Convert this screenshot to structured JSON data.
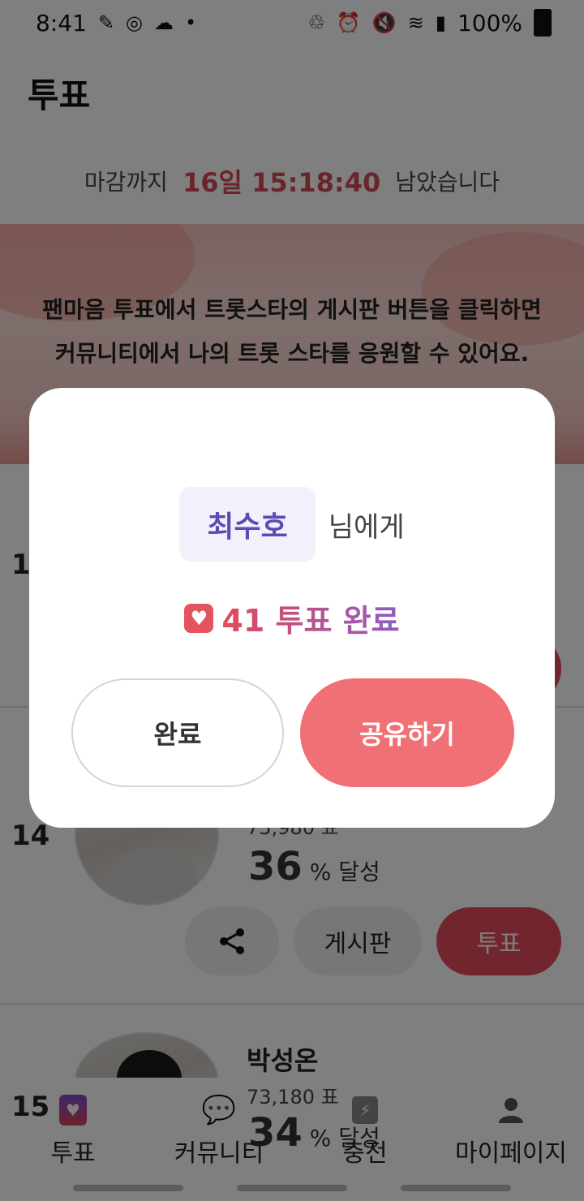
{
  "status_bar": {
    "time": "8:41",
    "battery": "100%"
  },
  "header": {
    "title": "투표"
  },
  "deadline": {
    "prefix": "마감까지",
    "countdown": "16일 15:18:40",
    "suffix": "남았습니다"
  },
  "banner": {
    "line1": "팬마음 투표에서 트롯스타의 게시판 버튼을 클릭하면",
    "line2": "커뮤니티에서 나의 트롯 스타를 응원할 수 있어요."
  },
  "list": [
    {
      "rank": "13",
      "name": "",
      "votes": "",
      "percent": "",
      "percent_label": ""
    },
    {
      "rank": "14",
      "name": "",
      "votes": "73,980 표",
      "percent": "36",
      "percent_label": "% 달성"
    },
    {
      "rank": "15",
      "name": "박성온",
      "votes": "73,180 표",
      "percent": "34",
      "percent_label": "% 달성"
    }
  ],
  "actions": {
    "board": "게시판",
    "vote": "투표"
  },
  "dialog": {
    "recipient": "최수호",
    "recipient_suffix": "님에게",
    "result": "41 투표 완료",
    "done_button": "완료",
    "share_button": "공유하기"
  },
  "bottom_nav": [
    {
      "label": "투표",
      "icon": "vote-heart-icon"
    },
    {
      "label": "커뮤니티",
      "icon": "chat-bubbles-icon"
    },
    {
      "label": "충전",
      "icon": "charge-bag-icon"
    },
    {
      "label": "마이페이지",
      "icon": "person-icon"
    }
  ]
}
